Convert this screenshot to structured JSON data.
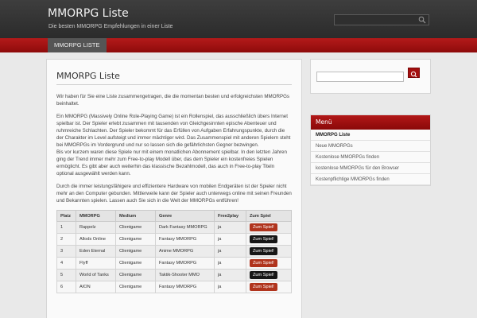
{
  "header": {
    "title": "MMORPG Liste",
    "description": "Die besten MMORPG Empfehlungen in einer Liste",
    "search_placeholder": ""
  },
  "nav": {
    "items": [
      {
        "label": "MMORPG LISTE"
      }
    ]
  },
  "main": {
    "title": "MMORPG Liste",
    "paragraphs": [
      "Wir haben für Sie eine Liste zusammengetragen, die die momentan besten und erfolgreichsten MMORPGs beinhaltet.",
      "Ein MMORPG (Massively Online Role-Playing Game) ist ein Rollenspiel, das ausschließlich übers Internet spielbar ist. Der Spieler erlebt zusammen mit tausenden von Gleichgesinnten epische Abenteuer und ruhmreiche Schlachten. Der Spieler bekommt für das Erfüllen von Aufgaben Erfahrungspunkte, durch die der Charakter im Level aufsteigt und immer mächtiger wird. Das Zusammenspiel mit anderen Spielern steht bei MMORPGs im Vordergrund und nur so lassen sich die gefährlichsten Gegner bezwingen.\nBis vor kurzem waren diese Spiele nur mit einem monatlichen Abonnement spielbar. In den letzten Jahren ging der Trend immer mehr zum Free-to-play Modell über, das dem Spieler ein kostenfreies Spielen ermöglicht. Es gibt aber auch weiterhin das klassische Bezahlmodell, das auch in Free-to-play Titeln optional ausgewählt werden kann.",
      "Durch die immer leistungsfähigere und effizientere Hardware von mobilen Endgeräten ist der Spieler nicht mehr an den Computer gebunden. Mittlerweile kann der Spieler auch unterwegs online mit seinen Freunden und Bekannten spielen. Lassen auch Sie sich in die Welt der MMORPGs entführen!"
    ],
    "table": {
      "headers": [
        "Platz",
        "MMORPG",
        "Medium",
        "Genre",
        "Free2play",
        "Zum Spiel"
      ],
      "rows": [
        {
          "rank": "1",
          "name": "Rappelz",
          "medium": "Clientgame",
          "genre": "Dark Fantasy MMORPG",
          "f2p": "ja",
          "button": "Zum Spiel!",
          "button_color": "#b0341d"
        },
        {
          "rank": "2",
          "name": "Allods Online",
          "medium": "Clientgame",
          "genre": "Fantasy MMORPG",
          "f2p": "ja",
          "button": "Zum Spiel!",
          "button_color": "#161616"
        },
        {
          "rank": "3",
          "name": "Eden Eternal",
          "medium": "Clientgame",
          "genre": "Anime MMORPG",
          "f2p": "ja",
          "button": "Zum Spiel!",
          "button_color": "#161616"
        },
        {
          "rank": "4",
          "name": "Flyff",
          "medium": "Clientgame",
          "genre": "Fantasy MMORPG",
          "f2p": "ja",
          "button": "Zum Spiel!",
          "button_color": "#b0341d"
        },
        {
          "rank": "5",
          "name": "World of Tanks",
          "medium": "Clientgame",
          "genre": "Taktik-Shooter MMO",
          "f2p": "ja",
          "button": "Zum Spiel!",
          "button_color": "#161616"
        },
        {
          "rank": "6",
          "name": "AION",
          "medium": "Clientgame",
          "genre": "Fantasy MMORPG",
          "f2p": "ja",
          "button": "Zum Spiel!",
          "button_color": "#b0341d"
        }
      ]
    }
  },
  "sidebar": {
    "search_placeholder": "",
    "menu_title": "Menü",
    "menu_items": [
      {
        "label": "MMORPG Liste"
      },
      {
        "label": "Neue MMORPGs"
      },
      {
        "label": "Kostenlose MMORPGs finden"
      },
      {
        "label": "kostenlose MMORPGs für den Browser"
      },
      {
        "label": "Kostenpflichtige MMORPGs finden"
      }
    ]
  },
  "colors": {
    "accent": "#a40f0f",
    "header_bg": "#333333"
  },
  "icons": {
    "search": "search-icon"
  }
}
